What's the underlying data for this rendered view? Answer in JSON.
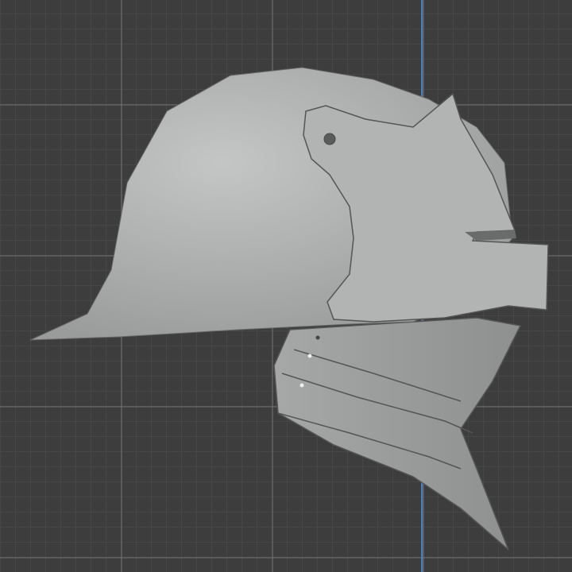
{
  "viewport": {
    "object": "helmet-model",
    "colors": {
      "background": "#3d3d3d",
      "grid": "#474747",
      "axis_z": "#4a7fc0",
      "mesh": "#b4b6b6"
    }
  }
}
